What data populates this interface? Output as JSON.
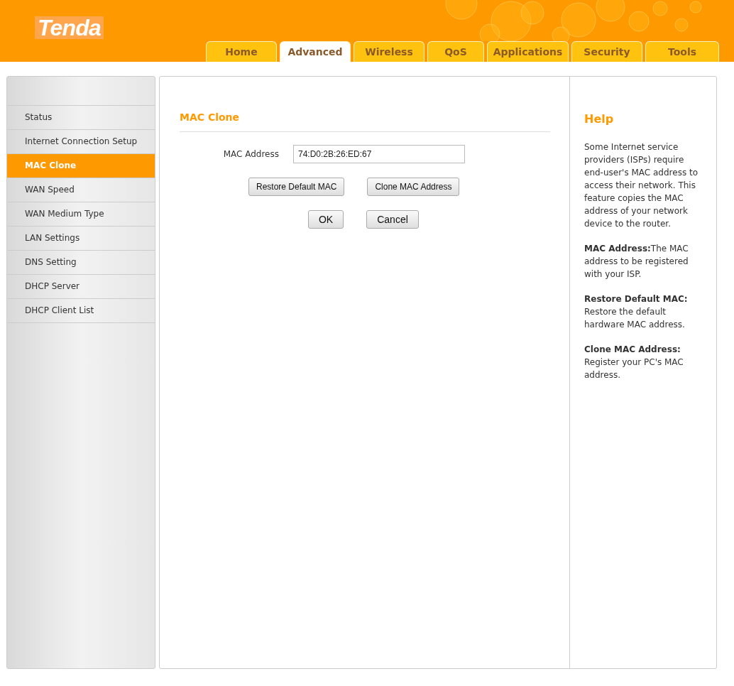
{
  "logo": {
    "text": "Tenda"
  },
  "tabs": [
    {
      "label": "Home",
      "selected": false
    },
    {
      "label": "Advanced",
      "selected": true
    },
    {
      "label": "Wireless",
      "selected": false
    },
    {
      "label": "QoS",
      "selected": false
    },
    {
      "label": "Applications",
      "selected": false
    },
    {
      "label": "Security",
      "selected": false
    },
    {
      "label": "Tools",
      "selected": false
    }
  ],
  "sidebar": {
    "items": [
      {
        "label": "Status",
        "selected": false
      },
      {
        "label": "Internet Connection Setup",
        "selected": false
      },
      {
        "label": "MAC Clone",
        "selected": true
      },
      {
        "label": "WAN Speed",
        "selected": false
      },
      {
        "label": "WAN Medium Type",
        "selected": false
      },
      {
        "label": "LAN Settings",
        "selected": false
      },
      {
        "label": "DNS Setting",
        "selected": false
      },
      {
        "label": "DHCP Server",
        "selected": false
      },
      {
        "label": "DHCP Client List",
        "selected": false
      }
    ]
  },
  "form": {
    "title": "MAC Clone",
    "field_label": "MAC Address",
    "field_value": "74:D0:2B:26:ED:67",
    "buttons": [
      "Restore Default MAC",
      "Clone MAC Address"
    ],
    "actions": [
      "OK",
      "Cancel"
    ]
  },
  "help": {
    "title": "Help",
    "paragraphs": [
      "Some Internet service providers (ISPs) require end-user's MAC address to access their network. This feature copies the MAC address of your network device to the router.",
      "**MAC Address:**The MAC address to be registered with your ISP.",
      "**Restore Default MAC:** Restore the default hardware MAC address.",
      "**Clone MAC Address:** Register your PC's MAC address."
    ]
  }
}
